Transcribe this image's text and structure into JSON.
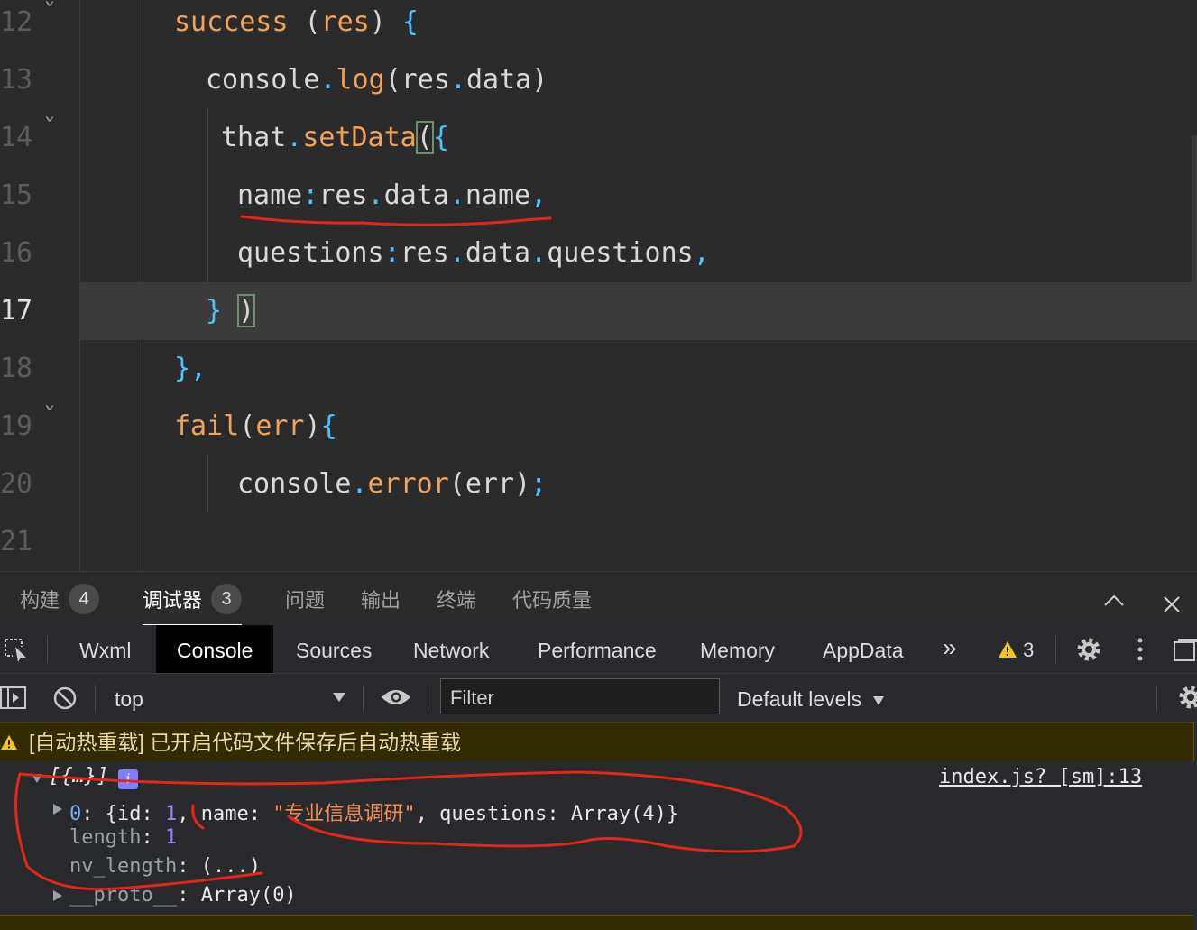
{
  "editor": {
    "lines": [
      {
        "num": "12",
        "tokens": [
          [
            "kw-orange",
            "success"
          ],
          [
            "txt",
            " "
          ],
          [
            "paren",
            "("
          ],
          [
            "kw-orange",
            "res"
          ],
          [
            "paren",
            ")"
          ],
          [
            "txt",
            " "
          ],
          [
            "kw-blue",
            "{"
          ]
        ]
      },
      {
        "num": "13",
        "tokens": [
          [
            "txt",
            "console"
          ],
          [
            "kw-blue",
            "."
          ],
          [
            "kw-orange",
            "log"
          ],
          [
            "paren",
            "("
          ],
          [
            "txt",
            "res"
          ],
          [
            "kw-blue",
            "."
          ],
          [
            "txt",
            "data"
          ],
          [
            "paren",
            ")"
          ]
        ]
      },
      {
        "num": "14",
        "tokens": [
          [
            "txt",
            "that"
          ],
          [
            "kw-blue",
            "."
          ],
          [
            "kw-orange",
            "setData"
          ],
          [
            "paren",
            "("
          ],
          [
            "kw-blue",
            "{"
          ]
        ]
      },
      {
        "num": "15",
        "tokens": [
          [
            "txt",
            "name"
          ],
          [
            "kw-blue",
            ":"
          ],
          [
            "txt",
            "res"
          ],
          [
            "kw-blue",
            "."
          ],
          [
            "txt",
            "data"
          ],
          [
            "kw-blue",
            "."
          ],
          [
            "txt",
            "name"
          ],
          [
            "kw-blue",
            ","
          ]
        ]
      },
      {
        "num": "16",
        "tokens": [
          [
            "txt",
            "questions"
          ],
          [
            "kw-blue",
            ":"
          ],
          [
            "txt",
            "res"
          ],
          [
            "kw-blue",
            "."
          ],
          [
            "txt",
            "data"
          ],
          [
            "kw-blue",
            "."
          ],
          [
            "txt",
            "questions"
          ],
          [
            "kw-blue",
            ","
          ]
        ]
      },
      {
        "num": "17",
        "tokens": [
          [
            "kw-blue",
            "}"
          ],
          [
            "txt",
            " "
          ],
          [
            "paren",
            ")"
          ]
        ]
      },
      {
        "num": "18",
        "tokens": [
          [
            "kw-blue",
            "},"
          ]
        ]
      },
      {
        "num": "19",
        "tokens": [
          [
            "kw-orange",
            "fail"
          ],
          [
            "paren",
            "("
          ],
          [
            "kw-orange",
            "err"
          ],
          [
            "paren",
            ")"
          ],
          [
            "kw-blue",
            "{"
          ]
        ]
      },
      {
        "num": "20",
        "tokens": [
          [
            "txt",
            "console"
          ],
          [
            "kw-blue",
            "."
          ],
          [
            "kw-orange",
            "error"
          ],
          [
            "paren",
            "("
          ],
          [
            "txt",
            "err"
          ],
          [
            "paren",
            ")"
          ],
          [
            "kw-blue",
            ";"
          ]
        ]
      },
      {
        "num": "21",
        "tokens": []
      }
    ]
  },
  "panel_tabs": {
    "build": "构建",
    "build_count": "4",
    "debugger": "调试器",
    "debugger_count": "3",
    "problems": "问题",
    "output": "输出",
    "terminal": "终端",
    "code_quality": "代码质量"
  },
  "devtools_tabs": {
    "wxml": "Wxml",
    "console": "Console",
    "sources": "Sources",
    "network": "Network",
    "performance": "Performance",
    "memory": "Memory",
    "appdata": "AppData",
    "more": "»",
    "warning_count": "3"
  },
  "console_toolbar": {
    "context": "top",
    "filter_placeholder": "Filter",
    "levels": "Default levels"
  },
  "messages": {
    "hot_reload": "[自动热重载] 已开启代码文件保存后自动热重载",
    "log_head": "[{…}]",
    "log_source": "index.js? [sm]:13",
    "item0_key": "0",
    "item0_id": "1",
    "item0_name": "\"专业信息调研\"",
    "item0_questions": "Array(4)",
    "length_key": "length",
    "length_val": "1",
    "nvlen_key": "nv_length",
    "nvlen_val": "(...)",
    "proto_key": "__proto__",
    "proto_val": "Array(0)"
  },
  "colors": {
    "accent_orange": "#f0a35a",
    "accent_blue": "#4fc1ff",
    "annotation_red": "#e3261c",
    "warning_bg": "#332b00"
  }
}
